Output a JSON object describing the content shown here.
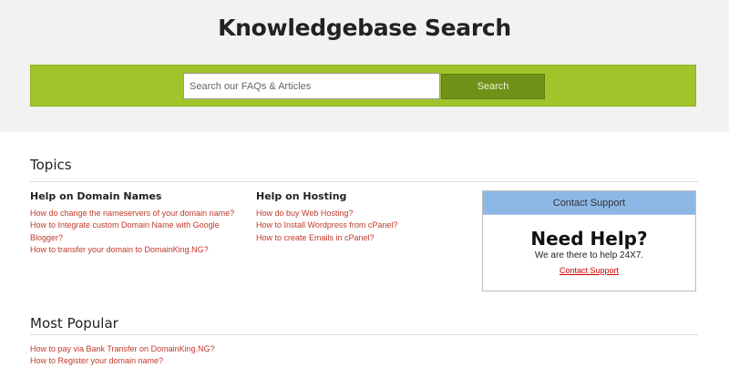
{
  "hero": {
    "title": "Knowledgebase Search",
    "search_placeholder": "Search our FAQs & Articles",
    "search_value": "",
    "search_button": "Search"
  },
  "topics": {
    "title": "Topics",
    "domain": {
      "title": "Help on Domain Names",
      "links": [
        "How do change the nameservers of your domain name?",
        "How to Integrate custom Domain Name with Google",
        "Blogger?",
        "How to transfer your domain to DomainKing.NG?"
      ]
    },
    "hosting": {
      "title": "Help on Hosting",
      "links": [
        "How do buy Web Hosting?",
        "How to Install Wordpress from cPanel?",
        "How to create Emails in cPanel?"
      ]
    }
  },
  "support": {
    "header": "Contact Support",
    "heading": "Need Help?",
    "subtext": "We are there to help 24X7.",
    "link": "Contact Support"
  },
  "popular": {
    "title": "Most Popular",
    "links": [
      "How to pay via Bank Transfer on DomainKing.NG?",
      "How to Register your domain name?"
    ]
  },
  "colors": {
    "accent_green": "#9fc52a",
    "button_green": "#6f9118",
    "link_red": "#c0392b",
    "support_header_blue": "#8db8e6"
  }
}
